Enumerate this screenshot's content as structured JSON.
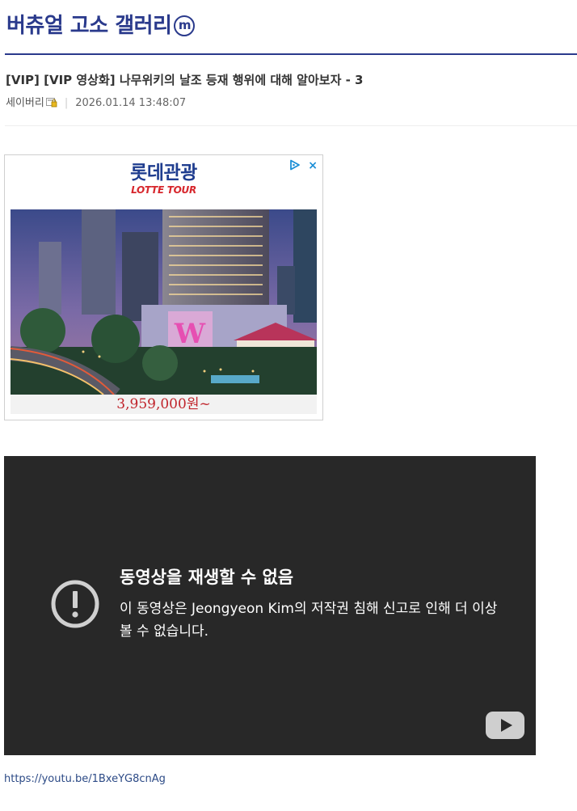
{
  "gallery": {
    "title": "버츄얼 고소 갤러리",
    "mobile_badge": "m"
  },
  "post": {
    "title": "[VIP] [VIP 영상화] 나무위키의 날조 등재 행위에 대해 알아보자 - 3",
    "author": "세이버리",
    "author_icon": "member-lock-icon",
    "separator": "|",
    "date": "2026.01.14 13:48:07"
  },
  "ad": {
    "brand_ko": "롯데관광",
    "brand_en": "LOTTE TOUR",
    "choice_icon": "adchoices-icon",
    "close_glyph": "×",
    "price": "3,959,000원~",
    "colors": {
      "brand": "#1f3d8f",
      "brand_en": "#d7262c",
      "price": "#c0242b",
      "adchoice": "#1a8ed6"
    }
  },
  "video": {
    "error_title": "동영상을 재생할 수 없음",
    "error_message": "이 동영상은 Jeongyeon Kim의 저작권 침해 신고로 인해 더 이상 볼 수 없습니다.",
    "error_icon": "exclamation-circle-icon",
    "play_icon": "youtube-logo-icon",
    "background": "#282828"
  },
  "link": {
    "url": "https://youtu.be/1BxeYG8cnAg"
  }
}
